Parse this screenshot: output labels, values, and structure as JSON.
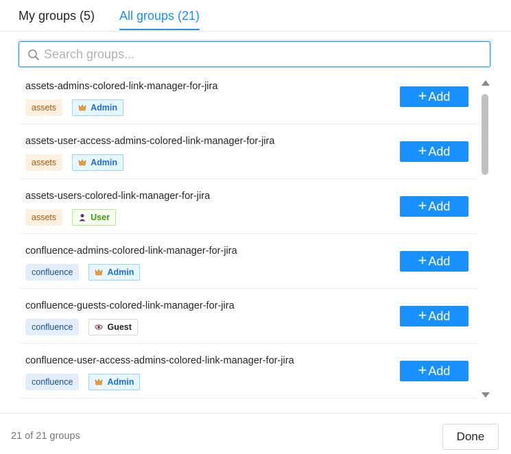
{
  "tabs": [
    {
      "label": "My groups (5)",
      "active": false
    },
    {
      "label": "All groups (21)",
      "active": true
    }
  ],
  "search": {
    "placeholder": "Search groups...",
    "value": "",
    "icon": "search-icon"
  },
  "colors": {
    "accent": "#1890ff",
    "assets_bg": "#fdf0e0",
    "confluence_bg": "#e3eefd"
  },
  "groups": [
    {
      "name": "assets-admins-colored-link-manager-for-jira",
      "product": "assets",
      "role": "Admin",
      "role_icon": "crown-icon",
      "add_label": "Add"
    },
    {
      "name": "assets-user-access-admins-colored-link-manager-for-jira",
      "product": "assets",
      "role": "Admin",
      "role_icon": "crown-icon",
      "add_label": "Add"
    },
    {
      "name": "assets-users-colored-link-manager-for-jira",
      "product": "assets",
      "role": "User",
      "role_icon": "person-icon",
      "add_label": "Add"
    },
    {
      "name": "confluence-admins-colored-link-manager-for-jira",
      "product": "confluence",
      "role": "Admin",
      "role_icon": "crown-icon",
      "add_label": "Add"
    },
    {
      "name": "confluence-guests-colored-link-manager-for-jira",
      "product": "confluence",
      "role": "Guest",
      "role_icon": "eye-icon",
      "add_label": "Add"
    },
    {
      "name": "confluence-user-access-admins-colored-link-manager-for-jira",
      "product": "confluence",
      "role": "Admin",
      "role_icon": "crown-icon",
      "add_label": "Add"
    }
  ],
  "footer": {
    "count_text": "21 of 21 groups",
    "done_label": "Done"
  }
}
